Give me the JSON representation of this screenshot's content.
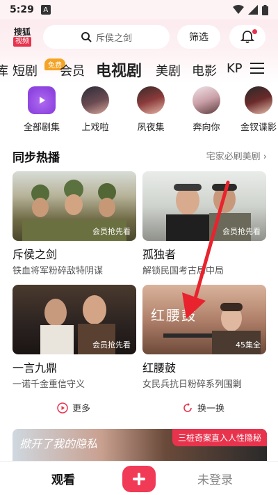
{
  "status_bar": {
    "time": "5:29",
    "a_label": "A"
  },
  "header": {
    "logo_line1": "搜狐",
    "logo_line2": "视频",
    "search_placeholder": "斥侯之剑",
    "filter_label": "筛选"
  },
  "tabs": [
    {
      "label": "库"
    },
    {
      "label": "短剧",
      "badge": "免费"
    },
    {
      "label": "会员"
    },
    {
      "label": "电视剧",
      "active": true
    },
    {
      "label": "美剧"
    },
    {
      "label": "电影"
    },
    {
      "label": "KP"
    }
  ],
  "categories": [
    {
      "label": "全部剧集"
    },
    {
      "label": "上戏啦"
    },
    {
      "label": "夙夜集"
    },
    {
      "label": "奔向你"
    },
    {
      "label": "金钗谍影"
    }
  ],
  "section": {
    "title": "同步热播",
    "more": "宅家必刷美剧"
  },
  "cards": [
    {
      "title": "斥侯之剑",
      "sub": "铁血将军粉碎敌特阴谋",
      "badge": "会员抢先看"
    },
    {
      "title": "孤独者",
      "sub": "解锁民国考古局中局",
      "badge": "会员抢先看"
    },
    {
      "title": "一言九鼎",
      "sub": "一诺千金重信守义",
      "badge": "会员抢先看"
    },
    {
      "title": "红腰鼓",
      "sub": "女民兵抗日粉碎系列围剿",
      "badge": "45集全",
      "overlay_text": "红腰鼓"
    }
  ],
  "actions": {
    "more": "更多",
    "refresh": "换一换"
  },
  "banner": {
    "tag": "三桩奇案直入人性隐秘",
    "overlay_text": "掀开了我的隐私"
  },
  "bottom_nav": {
    "watch": "观看",
    "login": "未登录"
  },
  "colors": {
    "brand": "#e8334d",
    "annotation_arrow": "#e8232d"
  }
}
